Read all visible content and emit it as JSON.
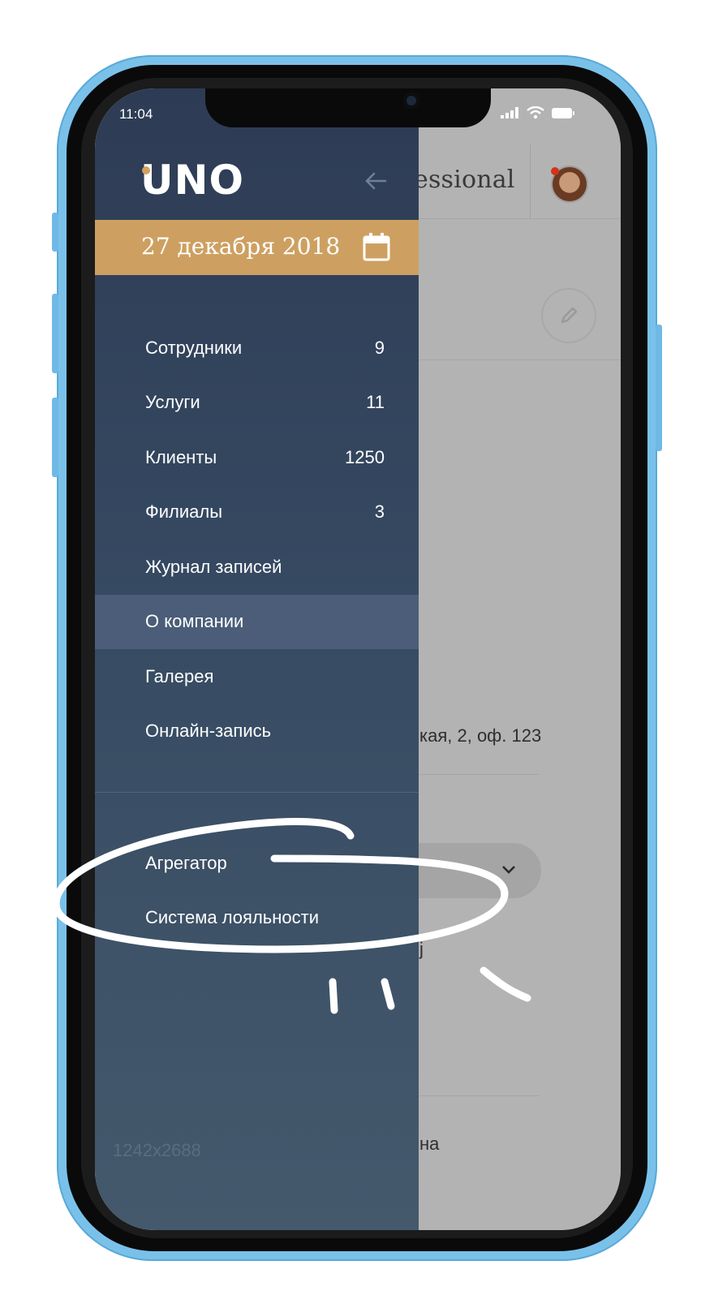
{
  "status_bar": {
    "time": "11:04"
  },
  "app": {
    "logo": "UNO",
    "date": "27 декабря 2018"
  },
  "menu": {
    "items": [
      {
        "label": "Сотрудники",
        "count": "9"
      },
      {
        "label": "Услуги",
        "count": "11"
      },
      {
        "label": "Клиенты",
        "count": "1250"
      },
      {
        "label": "Филиалы",
        "count": "3"
      },
      {
        "label": "Журнал записей",
        "count": ""
      },
      {
        "label": "О компании",
        "count": "",
        "active": true
      },
      {
        "label": "Галерея",
        "count": ""
      },
      {
        "label": "Онлайн-запись",
        "count": ""
      }
    ],
    "secondary": [
      {
        "label": "Агрегатор"
      },
      {
        "label": "Система лояльности"
      }
    ]
  },
  "background_screen": {
    "header_fragment": "essional",
    "address_fragment": "кая, 2, оф. 123",
    "bottom_fragment": "на",
    "mark_fragment": "ј"
  },
  "watermark": "1242x2688",
  "colors": {
    "drawer_top": "#2e3b55",
    "drawer_bottom": "#44596c",
    "date_bar": "#cda061",
    "active_item": "#4b5d78",
    "frame": "#7ac1ea"
  }
}
